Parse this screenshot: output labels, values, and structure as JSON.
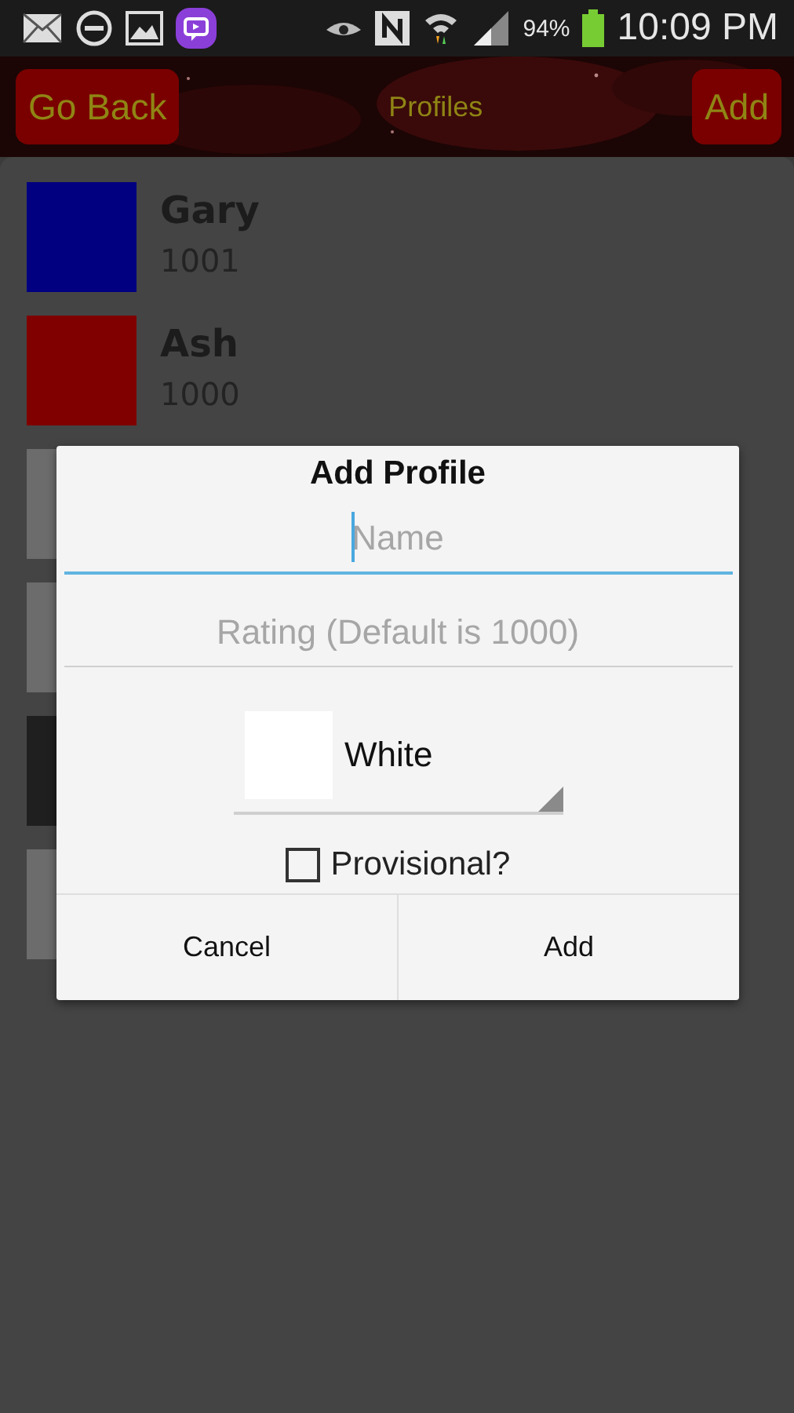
{
  "status_bar": {
    "battery": "94%",
    "time": "10:09 PM"
  },
  "header": {
    "back": "Go Back",
    "title": "Profiles",
    "add": "Add"
  },
  "profiles": [
    {
      "name": "Gary",
      "rating": "1001",
      "color": "#000080"
    },
    {
      "name": "Ash",
      "rating": "1000",
      "color": "#800000"
    },
    {
      "color": "#6c6c6c"
    },
    {
      "color": "#6c6c6c"
    },
    {
      "color": "#1f1f1f"
    },
    {
      "color": "#6c6c6c"
    }
  ],
  "dialog": {
    "title": "Add Profile",
    "name_field": {
      "placeholder": "Name",
      "focused": true
    },
    "rating_field": {
      "placeholder": "Rating (Default is 1000)",
      "focused": false
    },
    "color_picker": {
      "value": "White",
      "color": "#ffffff"
    },
    "provisional": {
      "label": "Provisional?",
      "checked": false
    },
    "buttons": [
      "Cancel",
      "Add"
    ]
  }
}
